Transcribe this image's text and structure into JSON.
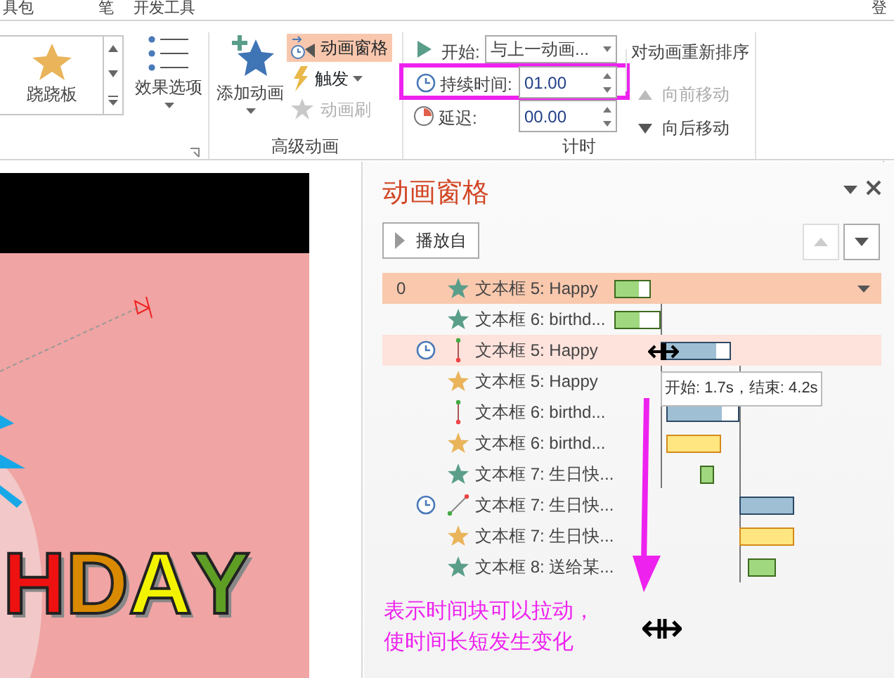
{
  "ribbon_tabs": [
    {
      "label": "具包"
    },
    {
      "label": "笔"
    },
    {
      "label": "开发工具"
    }
  ],
  "account": "登",
  "ribbon": {
    "gallery_item": "跷跷板",
    "effect_options": "效果选项",
    "add_animation": "添加动画",
    "advanced": {
      "items": [
        {
          "label": "动画窗格",
          "kind": "pane",
          "selected": true,
          "disabled": false
        },
        {
          "label": "触发",
          "kind": "trigger",
          "selected": false,
          "disabled": false
        },
        {
          "label": "动画刷",
          "kind": "painter",
          "selected": false,
          "disabled": true
        }
      ],
      "group_label": "高级动画"
    },
    "timing": {
      "start_label": "开始:",
      "start_value": "与上一动画...",
      "duration_label": "持续时间:",
      "duration_value": "01.00",
      "delay_label": "延迟:",
      "delay_value": "00.00",
      "group_label": "计时",
      "reorder_title": "对动画重新排序",
      "move": [
        {
          "label": "向前移动",
          "disabled": true
        },
        {
          "label": "向后移动",
          "disabled": false
        }
      ]
    }
  },
  "slide": {
    "wordart": "HDAY"
  },
  "pane": {
    "title": "动画窗格",
    "play_button": "播放自",
    "up_disabled": true,
    "down_disabled": false,
    "rows": [
      {
        "number": "0",
        "clock": false,
        "kind": "entrance",
        "label": "文本框 5: Happy",
        "selected": true,
        "hover": false
      },
      {
        "clock": false,
        "kind": "entrance",
        "label": "文本框 6: birthd...",
        "selected": false,
        "hover": false
      },
      {
        "clock": true,
        "kind": "motion-vertical",
        "label": "文本框 5: Happy",
        "selected": false,
        "hover": true
      },
      {
        "clock": false,
        "kind": "emphasis",
        "label": "文本框 5: Happy",
        "selected": false,
        "hover": false
      },
      {
        "clock": false,
        "kind": "motion-vertical",
        "label": "文本框 6: birthd...",
        "selected": false,
        "hover": false
      },
      {
        "clock": false,
        "kind": "emphasis",
        "label": "文本框 6: birthd...",
        "selected": false,
        "hover": false
      },
      {
        "clock": false,
        "kind": "entrance",
        "label": "文本框 7: 生日快...",
        "selected": false,
        "hover": false
      },
      {
        "clock": true,
        "kind": "motion-diagonal",
        "label": "文本框 7: 生日快...",
        "selected": false,
        "hover": false
      },
      {
        "clock": false,
        "kind": "emphasis",
        "label": "文本框 7: 生日快...",
        "selected": false,
        "hover": false
      },
      {
        "clock": false,
        "kind": "entrance",
        "label": "文本框 8: 送给某...",
        "selected": false,
        "hover": false
      }
    ],
    "tooltip": "开始: 1.7s，结束: 4.2s"
  },
  "annotation": {
    "lines": [
      "表示时间块可以拉动，",
      "使时间长短发生变化"
    ]
  }
}
